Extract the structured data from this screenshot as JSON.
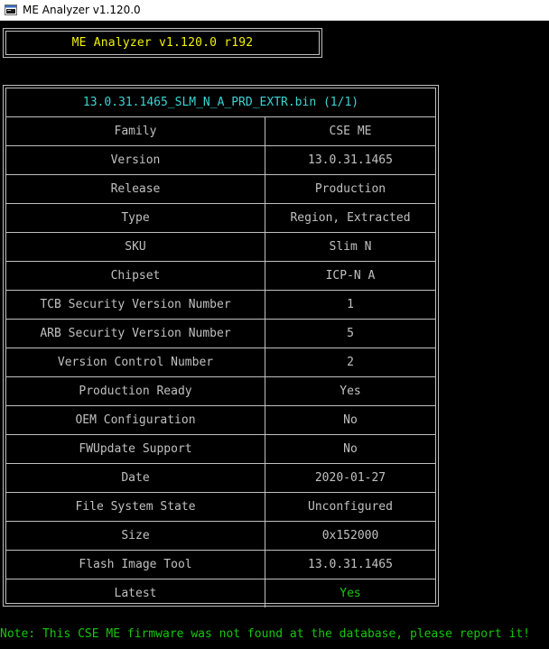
{
  "window": {
    "title": "ME Analyzer v1.120.0",
    "icon": "me-analyzer-app-icon"
  },
  "header": {
    "text": "ME Analyzer v1.120.0 r192"
  },
  "table": {
    "file_name": "13.0.31.1465_SLM_N_A_PRD_EXTR.bin (1/1)",
    "rows": [
      {
        "key": "Family",
        "value": "CSE ME"
      },
      {
        "key": "Version",
        "value": "13.0.31.1465"
      },
      {
        "key": "Release",
        "value": "Production"
      },
      {
        "key": "Type",
        "value": "Region, Extracted"
      },
      {
        "key": "SKU",
        "value": "Slim N"
      },
      {
        "key": "Chipset",
        "value": "ICP-N A"
      },
      {
        "key": "TCB Security Version Number",
        "value": "1"
      },
      {
        "key": "ARB Security Version Number",
        "value": "5"
      },
      {
        "key": "Version Control Number",
        "value": "2"
      },
      {
        "key": "Production Ready",
        "value": "Yes"
      },
      {
        "key": "OEM Configuration",
        "value": "No"
      },
      {
        "key": "FWUpdate Support",
        "value": "No"
      },
      {
        "key": "Date",
        "value": "2020-01-27"
      },
      {
        "key": "File System State",
        "value": "Unconfigured"
      },
      {
        "key": "Size",
        "value": "0x152000"
      },
      {
        "key": "Flash Image Tool",
        "value": "13.0.31.1465"
      },
      {
        "key": "Latest",
        "value": "Yes"
      }
    ]
  },
  "note": "Note: This CSE ME firmware was not found at the database, please report it!",
  "colors": {
    "background": "#000000",
    "header_text": "#f2f200",
    "file_name": "#3ad4d4",
    "table_text": "#c0c0c0",
    "latest_value": "#16c60c",
    "note_text": "#16c60c"
  }
}
